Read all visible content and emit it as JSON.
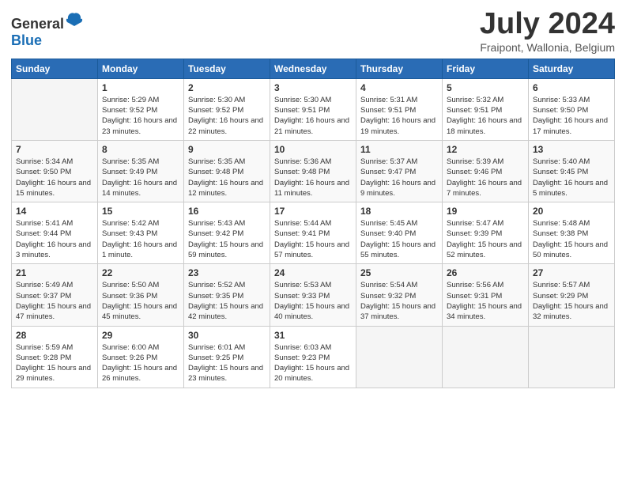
{
  "header": {
    "logo_general": "General",
    "logo_blue": "Blue",
    "month_title": "July 2024",
    "subtitle": "Fraipont, Wallonia, Belgium"
  },
  "weekdays": [
    "Sunday",
    "Monday",
    "Tuesday",
    "Wednesday",
    "Thursday",
    "Friday",
    "Saturday"
  ],
  "weeks": [
    [
      {
        "day": "",
        "empty": true
      },
      {
        "day": "1",
        "sunrise": "5:29 AM",
        "sunset": "9:52 PM",
        "daylight": "16 hours and 23 minutes."
      },
      {
        "day": "2",
        "sunrise": "5:30 AM",
        "sunset": "9:52 PM",
        "daylight": "16 hours and 22 minutes."
      },
      {
        "day": "3",
        "sunrise": "5:30 AM",
        "sunset": "9:51 PM",
        "daylight": "16 hours and 21 minutes."
      },
      {
        "day": "4",
        "sunrise": "5:31 AM",
        "sunset": "9:51 PM",
        "daylight": "16 hours and 19 minutes."
      },
      {
        "day": "5",
        "sunrise": "5:32 AM",
        "sunset": "9:51 PM",
        "daylight": "16 hours and 18 minutes."
      },
      {
        "day": "6",
        "sunrise": "5:33 AM",
        "sunset": "9:50 PM",
        "daylight": "16 hours and 17 minutes."
      }
    ],
    [
      {
        "day": "7",
        "sunrise": "5:34 AM",
        "sunset": "9:50 PM",
        "daylight": "16 hours and 15 minutes."
      },
      {
        "day": "8",
        "sunrise": "5:35 AM",
        "sunset": "9:49 PM",
        "daylight": "16 hours and 14 minutes."
      },
      {
        "day": "9",
        "sunrise": "5:35 AM",
        "sunset": "9:48 PM",
        "daylight": "16 hours and 12 minutes."
      },
      {
        "day": "10",
        "sunrise": "5:36 AM",
        "sunset": "9:48 PM",
        "daylight": "16 hours and 11 minutes."
      },
      {
        "day": "11",
        "sunrise": "5:37 AM",
        "sunset": "9:47 PM",
        "daylight": "16 hours and 9 minutes."
      },
      {
        "day": "12",
        "sunrise": "5:39 AM",
        "sunset": "9:46 PM",
        "daylight": "16 hours and 7 minutes."
      },
      {
        "day": "13",
        "sunrise": "5:40 AM",
        "sunset": "9:45 PM",
        "daylight": "16 hours and 5 minutes."
      }
    ],
    [
      {
        "day": "14",
        "sunrise": "5:41 AM",
        "sunset": "9:44 PM",
        "daylight": "16 hours and 3 minutes."
      },
      {
        "day": "15",
        "sunrise": "5:42 AM",
        "sunset": "9:43 PM",
        "daylight": "16 hours and 1 minute."
      },
      {
        "day": "16",
        "sunrise": "5:43 AM",
        "sunset": "9:42 PM",
        "daylight": "15 hours and 59 minutes."
      },
      {
        "day": "17",
        "sunrise": "5:44 AM",
        "sunset": "9:41 PM",
        "daylight": "15 hours and 57 minutes."
      },
      {
        "day": "18",
        "sunrise": "5:45 AM",
        "sunset": "9:40 PM",
        "daylight": "15 hours and 55 minutes."
      },
      {
        "day": "19",
        "sunrise": "5:47 AM",
        "sunset": "9:39 PM",
        "daylight": "15 hours and 52 minutes."
      },
      {
        "day": "20",
        "sunrise": "5:48 AM",
        "sunset": "9:38 PM",
        "daylight": "15 hours and 50 minutes."
      }
    ],
    [
      {
        "day": "21",
        "sunrise": "5:49 AM",
        "sunset": "9:37 PM",
        "daylight": "15 hours and 47 minutes."
      },
      {
        "day": "22",
        "sunrise": "5:50 AM",
        "sunset": "9:36 PM",
        "daylight": "15 hours and 45 minutes."
      },
      {
        "day": "23",
        "sunrise": "5:52 AM",
        "sunset": "9:35 PM",
        "daylight": "15 hours and 42 minutes."
      },
      {
        "day": "24",
        "sunrise": "5:53 AM",
        "sunset": "9:33 PM",
        "daylight": "15 hours and 40 minutes."
      },
      {
        "day": "25",
        "sunrise": "5:54 AM",
        "sunset": "9:32 PM",
        "daylight": "15 hours and 37 minutes."
      },
      {
        "day": "26",
        "sunrise": "5:56 AM",
        "sunset": "9:31 PM",
        "daylight": "15 hours and 34 minutes."
      },
      {
        "day": "27",
        "sunrise": "5:57 AM",
        "sunset": "9:29 PM",
        "daylight": "15 hours and 32 minutes."
      }
    ],
    [
      {
        "day": "28",
        "sunrise": "5:59 AM",
        "sunset": "9:28 PM",
        "daylight": "15 hours and 29 minutes."
      },
      {
        "day": "29",
        "sunrise": "6:00 AM",
        "sunset": "9:26 PM",
        "daylight": "15 hours and 26 minutes."
      },
      {
        "day": "30",
        "sunrise": "6:01 AM",
        "sunset": "9:25 PM",
        "daylight": "15 hours and 23 minutes."
      },
      {
        "day": "31",
        "sunrise": "6:03 AM",
        "sunset": "9:23 PM",
        "daylight": "15 hours and 20 minutes."
      },
      {
        "day": "",
        "empty": true
      },
      {
        "day": "",
        "empty": true
      },
      {
        "day": "",
        "empty": true
      }
    ]
  ]
}
